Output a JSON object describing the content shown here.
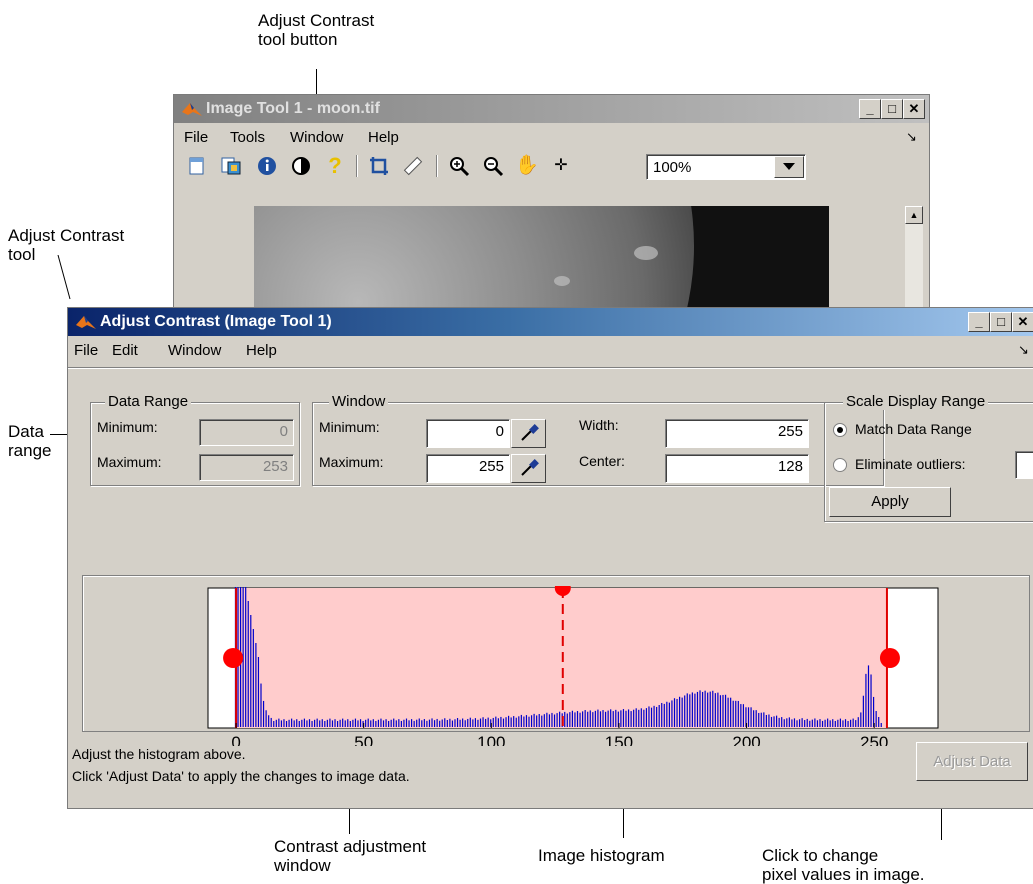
{
  "callouts": {
    "contrast_button": [
      "Adjust Contrast",
      "tool button"
    ],
    "contrast_tool": [
      "Adjust Contrast",
      "tool"
    ],
    "data_range": [
      "Data",
      "range"
    ],
    "adjust_window": [
      "Contrast adjustment",
      "window"
    ],
    "histogram": "Image histogram",
    "click_change": [
      "Click to change",
      "pixel values in image."
    ]
  },
  "image_tool": {
    "title": "Image Tool 1 - moon.tif",
    "menu": [
      "File",
      "Tools",
      "Window",
      "Help"
    ],
    "zoom_value": "100%",
    "toolbar_icons": [
      "new-figure-icon",
      "overview-icon",
      "info-icon",
      "contrast-icon",
      "help-icon",
      "crop-icon",
      "ruler-icon",
      "zoom-in-icon",
      "zoom-out-icon",
      "pan-hand-icon",
      "pixel-region-icon"
    ]
  },
  "contrast": {
    "title": "Adjust Contrast (Image Tool 1)",
    "menu": [
      "File",
      "Edit",
      "Window",
      "Help"
    ],
    "data_range": {
      "label": "Data Range",
      "min_label": "Minimum:",
      "min_value": "0",
      "max_label": "Maximum:",
      "max_value": "253"
    },
    "window": {
      "label": "Window",
      "min_label": "Minimum:",
      "min_value": "0",
      "max_label": "Maximum:",
      "max_value": "255",
      "width_label": "Width:",
      "width_value": "255",
      "center_label": "Center:",
      "center_value": "128"
    },
    "scale": {
      "label": "Scale Display Range",
      "match": "Match Data Range",
      "eliminate": "Eliminate outliers:",
      "apply": "Apply"
    },
    "instructions": [
      "Adjust the histogram above.",
      "Click 'Adjust Data' to apply the changes to image data."
    ],
    "adjust_button": "Adjust Data"
  },
  "chart_data": {
    "type": "bar",
    "xlim": [
      -11,
      275
    ],
    "x_ticks": [
      0,
      50,
      100,
      150,
      200,
      250
    ],
    "window_min": 0,
    "window_max": 255,
    "window_center": 128,
    "colors": {
      "bars": "#0000cc",
      "window_fill": "#ffcccc",
      "window_line": "#e00000"
    }
  }
}
